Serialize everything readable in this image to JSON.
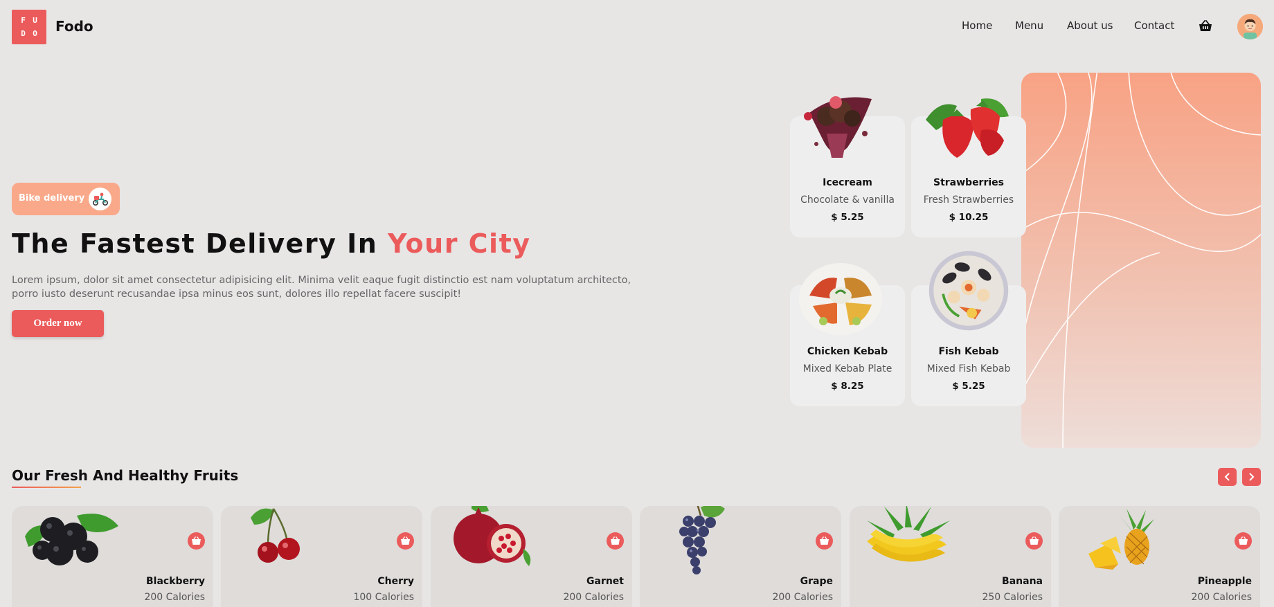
{
  "header": {
    "logo_letters": [
      "F",
      "U",
      "D",
      "O"
    ],
    "brand": "Fodo",
    "nav": [
      {
        "label": "Home"
      },
      {
        "label": "Menu"
      },
      {
        "label": "About us"
      },
      {
        "label": "Contact"
      }
    ],
    "icons": {
      "cart": "basket-icon",
      "avatar": "user-avatar"
    }
  },
  "hero": {
    "badge": "Bike delivery",
    "badge_icon": "scooter-delivery-icon",
    "title_main": "The Fastest Delivery In ",
    "title_accent": "Your City",
    "description": "Lorem ipsum, dolor sit amet consectetur adipisicing elit. Minima velit eaque fugit distinctio est nam voluptatum architecto, porro iusto deserunt recusandae ipsa minus eos sunt, dolores illo repellat facere suscipit!",
    "cta": "Order now",
    "accent_color": "#eb5b5b",
    "badge_color": "#f9a98a"
  },
  "featured": [
    {
      "name": "Icecream",
      "desc": "Chocolate & vanilla",
      "price": "$ 5.25"
    },
    {
      "name": "Strawberries",
      "desc": "Fresh Strawberries",
      "price": "$ 10.25"
    },
    {
      "name": "Chicken Kebab",
      "desc": "Mixed Kebab Plate",
      "price": "$ 8.25"
    },
    {
      "name": "Fish Kebab",
      "desc": "Mixed Fish Kebab",
      "price": "$ 5.25"
    }
  ],
  "fruits_section": {
    "title": "Our Fresh And Healthy Fruits",
    "items": [
      {
        "name": "Blackberry",
        "calories": "200 Calories"
      },
      {
        "name": "Cherry",
        "calories": "100 Calories"
      },
      {
        "name": "Garnet",
        "calories": "200 Calories"
      },
      {
        "name": "Grape",
        "calories": "200 Calories"
      },
      {
        "name": "Banana",
        "calories": "250 Calories"
      },
      {
        "name": "Pineapple",
        "calories": "200 Calories"
      }
    ]
  }
}
